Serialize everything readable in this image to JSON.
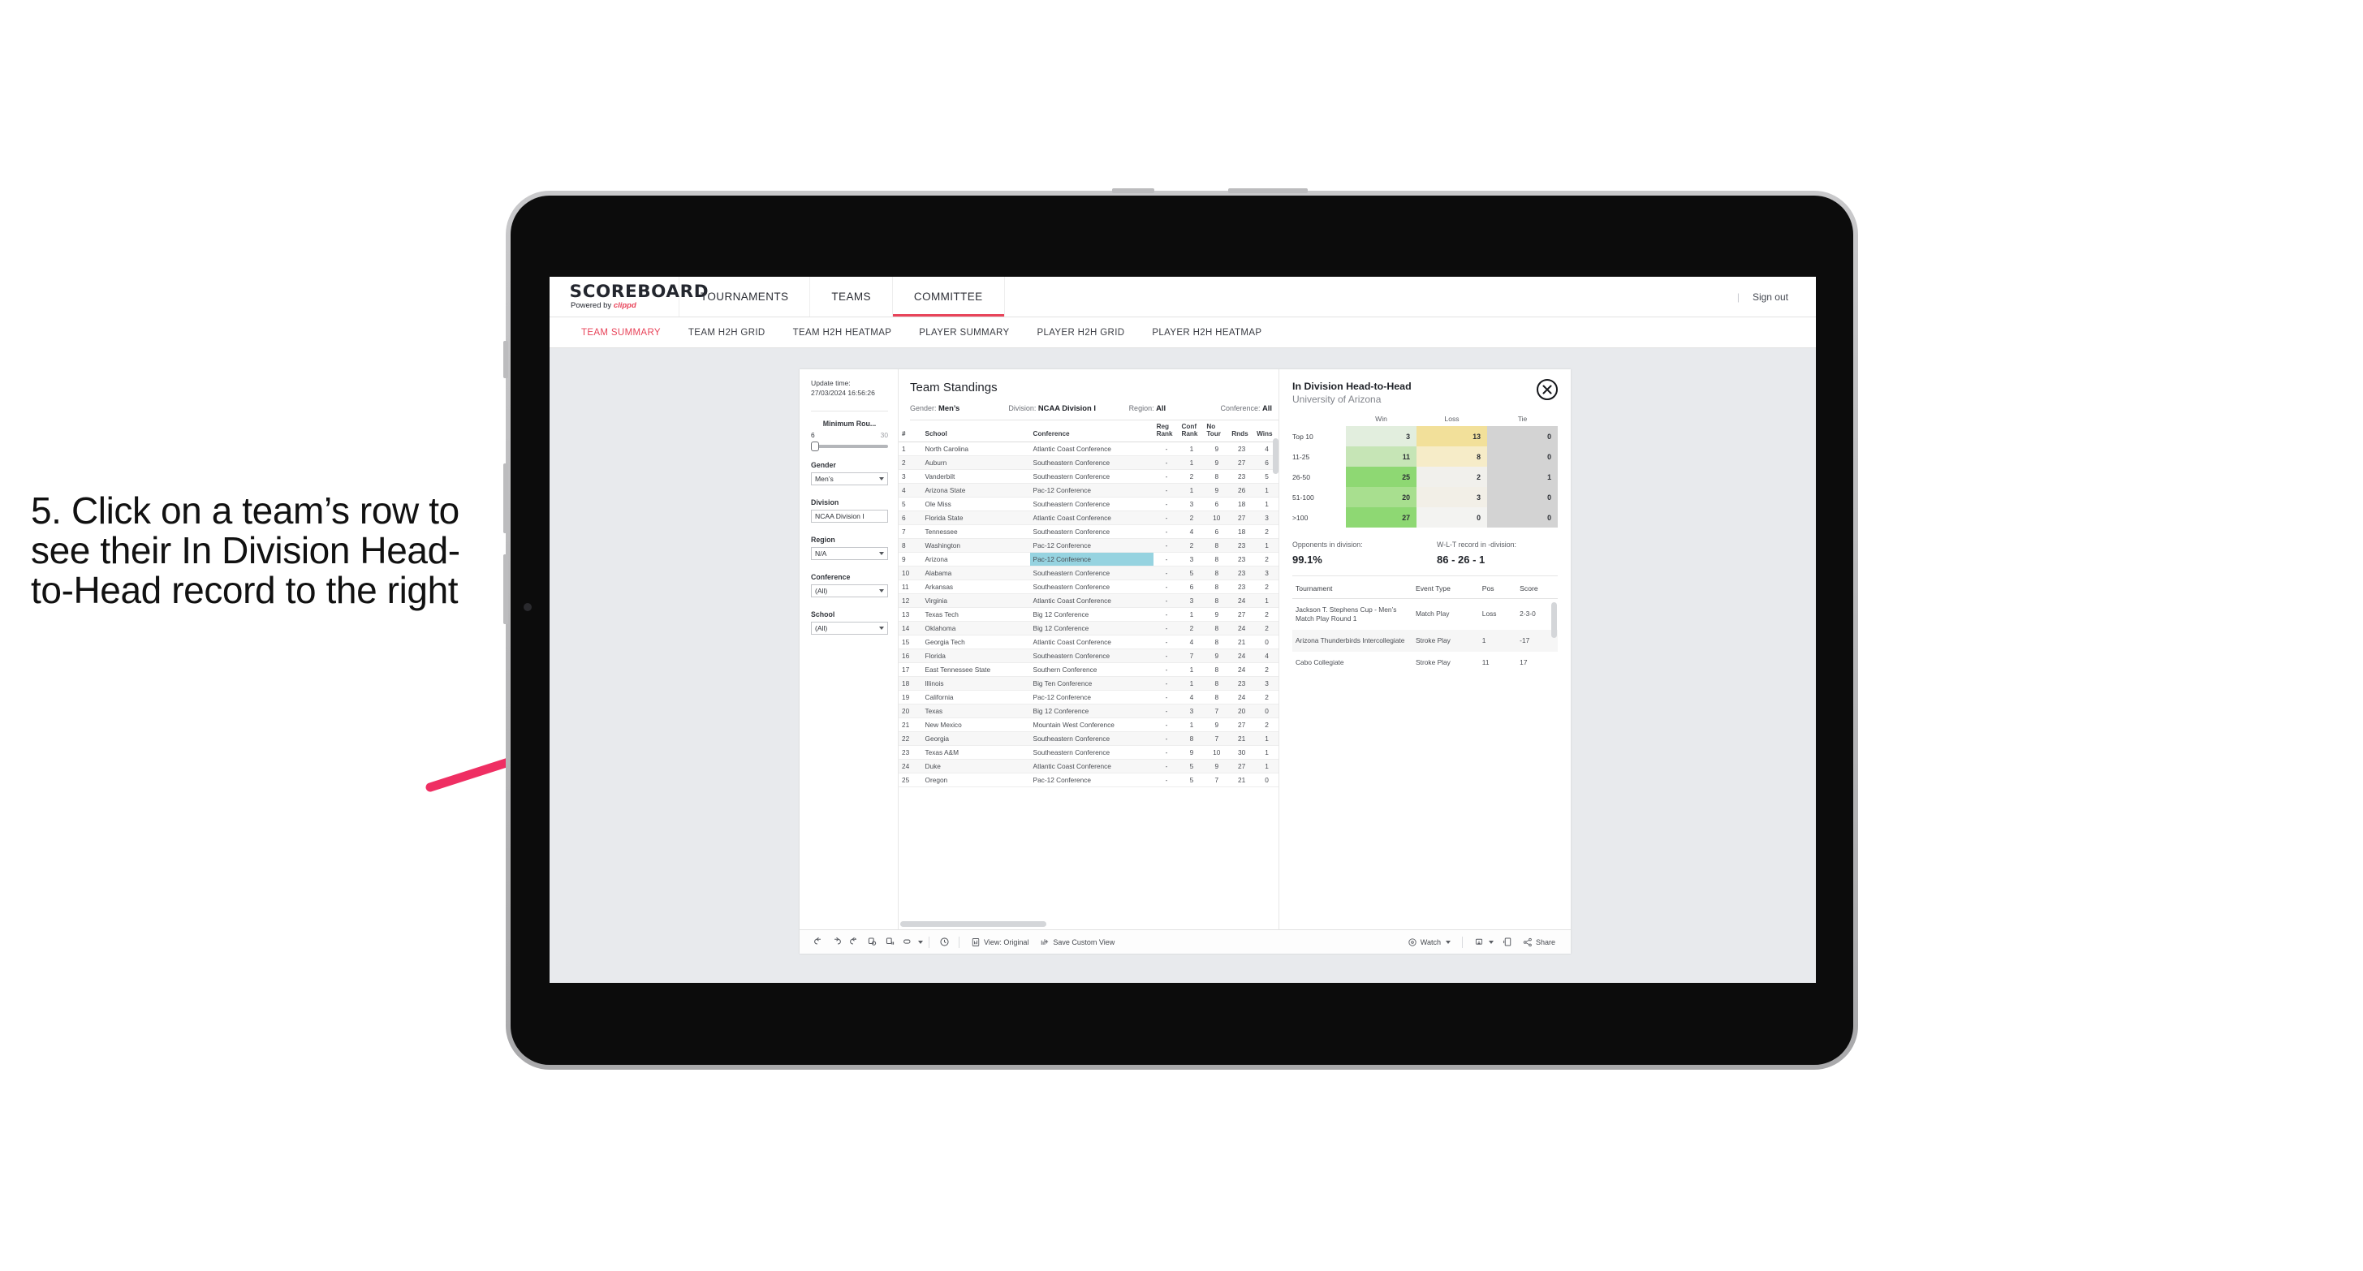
{
  "instruction": "5. Click on a team’s row to see their In Division Head-to-Head record to the right",
  "colors": {
    "accent": "#e8445a",
    "highlight": "#96d3e0",
    "arrow": "#ef2f63"
  },
  "header": {
    "logo_main": "SCOREBOARD",
    "logo_powered": "Powered by ",
    "logo_brand": "clippd",
    "nav": [
      {
        "label": "TOURNAMENTS",
        "active": false
      },
      {
        "label": "TEAMS",
        "active": false
      },
      {
        "label": "COMMITTEE",
        "active": true
      }
    ],
    "sign_out": "Sign out",
    "separator": "|"
  },
  "subnav": [
    {
      "label": "TEAM SUMMARY",
      "active": true
    },
    {
      "label": "TEAM H2H GRID",
      "active": false
    },
    {
      "label": "TEAM H2H HEATMAP",
      "active": false
    },
    {
      "label": "PLAYER SUMMARY",
      "active": false
    },
    {
      "label": "PLAYER H2H GRID",
      "active": false
    },
    {
      "label": "PLAYER H2H HEATMAP",
      "active": false
    }
  ],
  "filters": {
    "update_time_label": "Update time:",
    "update_time_value": "27/03/2024 16:56:26",
    "min_rounds": {
      "label": "Minimum Rou...",
      "min": "6",
      "max": "30"
    },
    "groups": [
      {
        "label": "Gender",
        "value": "Men’s"
      },
      {
        "label": "Division",
        "value": "NCAA Division I"
      },
      {
        "label": "Region",
        "value": "N/A"
      },
      {
        "label": "Conference",
        "value": "(All)"
      },
      {
        "label": "School",
        "value": "(All)"
      }
    ]
  },
  "standings": {
    "title": "Team Standings",
    "meta": [
      {
        "label": "Gender:",
        "value": "Men’s"
      },
      {
        "label": "Division:",
        "value": "NCAA Division I"
      },
      {
        "label": "Region:",
        "value": "All"
      },
      {
        "label": "Conference:",
        "value": "All"
      }
    ],
    "columns": [
      "#",
      "School",
      "Conference",
      "Reg Rank",
      "Conf Rank",
      "No Tour",
      "Rnds",
      "Wins"
    ],
    "rows": [
      {
        "rank": "1",
        "school": "North Carolina",
        "conference": "Atlantic Coast Conference",
        "reg": "-",
        "conf": "1",
        "notour": "9",
        "rnds": "23",
        "wins": "4"
      },
      {
        "rank": "2",
        "school": "Auburn",
        "conference": "Southeastern Conference",
        "reg": "-",
        "conf": "1",
        "notour": "9",
        "rnds": "27",
        "wins": "6"
      },
      {
        "rank": "3",
        "school": "Vanderbilt",
        "conference": "Southeastern Conference",
        "reg": "-",
        "conf": "2",
        "notour": "8",
        "rnds": "23",
        "wins": "5"
      },
      {
        "rank": "4",
        "school": "Arizona State",
        "conference": "Pac-12 Conference",
        "reg": "-",
        "conf": "1",
        "notour": "9",
        "rnds": "26",
        "wins": "1"
      },
      {
        "rank": "5",
        "school": "Ole Miss",
        "conference": "Southeastern Conference",
        "reg": "-",
        "conf": "3",
        "notour": "6",
        "rnds": "18",
        "wins": "1"
      },
      {
        "rank": "6",
        "school": "Florida State",
        "conference": "Atlantic Coast Conference",
        "reg": "-",
        "conf": "2",
        "notour": "10",
        "rnds": "27",
        "wins": "3"
      },
      {
        "rank": "7",
        "school": "Tennessee",
        "conference": "Southeastern Conference",
        "reg": "-",
        "conf": "4",
        "notour": "6",
        "rnds": "18",
        "wins": "2"
      },
      {
        "rank": "8",
        "school": "Washington",
        "conference": "Pac-12 Conference",
        "reg": "-",
        "conf": "2",
        "notour": "8",
        "rnds": "23",
        "wins": "1"
      },
      {
        "rank": "9",
        "school": "Arizona",
        "conference": "Pac-12 Conference",
        "reg": "-",
        "conf": "3",
        "notour": "8",
        "rnds": "23",
        "wins": "2",
        "selected": true
      },
      {
        "rank": "10",
        "school": "Alabama",
        "conference": "Southeastern Conference",
        "reg": "-",
        "conf": "5",
        "notour": "8",
        "rnds": "23",
        "wins": "3"
      },
      {
        "rank": "11",
        "school": "Arkansas",
        "conference": "Southeastern Conference",
        "reg": "-",
        "conf": "6",
        "notour": "8",
        "rnds": "23",
        "wins": "2"
      },
      {
        "rank": "12",
        "school": "Virginia",
        "conference": "Atlantic Coast Conference",
        "reg": "-",
        "conf": "3",
        "notour": "8",
        "rnds": "24",
        "wins": "1"
      },
      {
        "rank": "13",
        "school": "Texas Tech",
        "conference": "Big 12 Conference",
        "reg": "-",
        "conf": "1",
        "notour": "9",
        "rnds": "27",
        "wins": "2"
      },
      {
        "rank": "14",
        "school": "Oklahoma",
        "conference": "Big 12 Conference",
        "reg": "-",
        "conf": "2",
        "notour": "8",
        "rnds": "24",
        "wins": "2"
      },
      {
        "rank": "15",
        "school": "Georgia Tech",
        "conference": "Atlantic Coast Conference",
        "reg": "-",
        "conf": "4",
        "notour": "8",
        "rnds": "21",
        "wins": "0"
      },
      {
        "rank": "16",
        "school": "Florida",
        "conference": "Southeastern Conference",
        "reg": "-",
        "conf": "7",
        "notour": "9",
        "rnds": "24",
        "wins": "4"
      },
      {
        "rank": "17",
        "school": "East Tennessee State",
        "conference": "Southern Conference",
        "reg": "-",
        "conf": "1",
        "notour": "8",
        "rnds": "24",
        "wins": "2"
      },
      {
        "rank": "18",
        "school": "Illinois",
        "conference": "Big Ten Conference",
        "reg": "-",
        "conf": "1",
        "notour": "8",
        "rnds": "23",
        "wins": "3"
      },
      {
        "rank": "19",
        "school": "California",
        "conference": "Pac-12 Conference",
        "reg": "-",
        "conf": "4",
        "notour": "8",
        "rnds": "24",
        "wins": "2"
      },
      {
        "rank": "20",
        "school": "Texas",
        "conference": "Big 12 Conference",
        "reg": "-",
        "conf": "3",
        "notour": "7",
        "rnds": "20",
        "wins": "0"
      },
      {
        "rank": "21",
        "school": "New Mexico",
        "conference": "Mountain West Conference",
        "reg": "-",
        "conf": "1",
        "notour": "9",
        "rnds": "27",
        "wins": "2"
      },
      {
        "rank": "22",
        "school": "Georgia",
        "conference": "Southeastern Conference",
        "reg": "-",
        "conf": "8",
        "notour": "7",
        "rnds": "21",
        "wins": "1"
      },
      {
        "rank": "23",
        "school": "Texas A&M",
        "conference": "Southeastern Conference",
        "reg": "-",
        "conf": "9",
        "notour": "10",
        "rnds": "30",
        "wins": "1"
      },
      {
        "rank": "24",
        "school": "Duke",
        "conference": "Atlantic Coast Conference",
        "reg": "-",
        "conf": "5",
        "notour": "9",
        "rnds": "27",
        "wins": "1"
      },
      {
        "rank": "25",
        "school": "Oregon",
        "conference": "Pac-12 Conference",
        "reg": "-",
        "conf": "5",
        "notour": "7",
        "rnds": "21",
        "wins": "0"
      }
    ]
  },
  "h2h": {
    "title": "In Division Head-to-Head",
    "subtitle": "University of Arizona",
    "close_icon": "close-icon",
    "matrix_columns": [
      "",
      "Win",
      "Loss",
      "Tie"
    ],
    "matrix_rows": [
      {
        "label": "Top 10",
        "win": "3",
        "loss": "13",
        "tie": "0",
        "win_color": "#e2eede",
        "loss_color": "#f2e09a",
        "tie_color": "#d3d3d3"
      },
      {
        "label": "11-25",
        "win": "11",
        "loss": "8",
        "tie": "0",
        "win_color": "#c6e5b6",
        "loss_color": "#f6ecc8",
        "tie_color": "#d3d3d3"
      },
      {
        "label": "26-50",
        "win": "25",
        "loss": "2",
        "tie": "1",
        "win_color": "#8ed873",
        "loss_color": "#f1f0ec",
        "tie_color": "#d3d3d3"
      },
      {
        "label": "51-100",
        "win": "20",
        "loss": "3",
        "tie": "0",
        "win_color": "#a8df8f",
        "loss_color": "#f2efe7",
        "tie_color": "#d3d3d3"
      },
      {
        "label": ">100",
        "win": "27",
        "loss": "0",
        "tie": "0",
        "win_color": "#8ed873",
        "loss_color": "#f3f3f1",
        "tie_color": "#d3d3d3"
      }
    ],
    "stats": [
      {
        "label": "Opponents in division:",
        "value": "99.1%"
      },
      {
        "label": "W-L-T record in -division:",
        "value": "86 - 26 - 1"
      }
    ],
    "tournament_columns": [
      "Tournament",
      "Event Type",
      "Pos",
      "Score"
    ],
    "tournament_rows": [
      {
        "name": "Jackson T. Stephens Cup - Men’s Match Play Round 1",
        "type": "Match Play",
        "pos": "Loss",
        "score": "2-3-0"
      },
      {
        "name": "Arizona Thunderbirds Intercollegiate",
        "type": "Stroke Play",
        "pos": "1",
        "score": "-17"
      },
      {
        "name": "Cabo Collegiate",
        "type": "Stroke Play",
        "pos": "11",
        "score": "17"
      }
    ]
  },
  "toolbar": {
    "icons": [
      "undo-icon",
      "redo-icon",
      "revert-icon",
      "refresh-icon",
      "pause-icon",
      "highlight-icon"
    ],
    "clock_icon": "clock-icon",
    "view_label": "View: Original",
    "save_label": "Save Custom View",
    "watch_label": "Watch",
    "share_label": "Share",
    "download_icon": "download-icon",
    "fullscreen_icon": "fullscreen-icon",
    "share_icon": "share-icon"
  }
}
